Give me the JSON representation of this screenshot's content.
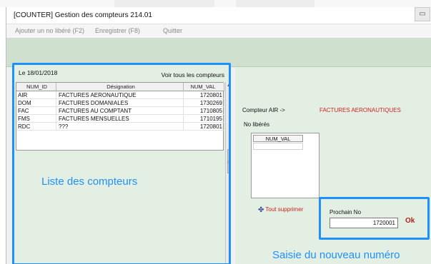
{
  "window": {
    "title": "[COUNTER] Gestion des compteurs 214.01"
  },
  "menu": {
    "items": [
      "Ajouter un no libéré (F2)",
      "Enregistrer (F8)",
      "Quitter"
    ]
  },
  "list_panel": {
    "date_label": "Le   18/01/2018",
    "view_all": "Voir tous les compteurs",
    "columns": [
      "NUM_ID",
      "Désignation",
      "NUM_VAL"
    ],
    "rows": [
      {
        "id": "AIR",
        "designation": "FACTURES AERONAUTIQUE",
        "value": "1720801"
      },
      {
        "id": "DOM",
        "designation": "FACTURES DOMANIALES",
        "value": "1730269"
      },
      {
        "id": "FAC",
        "designation": "FACTURES AU COMPTANT",
        "value": "1710805"
      },
      {
        "id": "FMS",
        "designation": "FACTURES MENSUELLES",
        "value": "1710195"
      },
      {
        "id": "RDC",
        "designation": "???",
        "value": "1720801"
      }
    ],
    "caption": "Liste des compteurs"
  },
  "counter_panel": {
    "counter_label": "Compteur AIR ->",
    "counter_name": "FACTURES AERONAUTIQUES",
    "freed_label": "No libérés",
    "freed_column": "NUM_VAL",
    "delete_all": "Tout supprimer",
    "next_label": "Prochain No",
    "next_value": "1720001",
    "ok": "Ok",
    "caption": "Saisie du nouveau numéro"
  },
  "icons": {
    "app": "counter-app-icon",
    "delete": "delete-all-icon"
  },
  "colors": {
    "highlight_border": "#1e90ff",
    "panel_background": "#e4efe3",
    "counter_name": "#d12020"
  }
}
